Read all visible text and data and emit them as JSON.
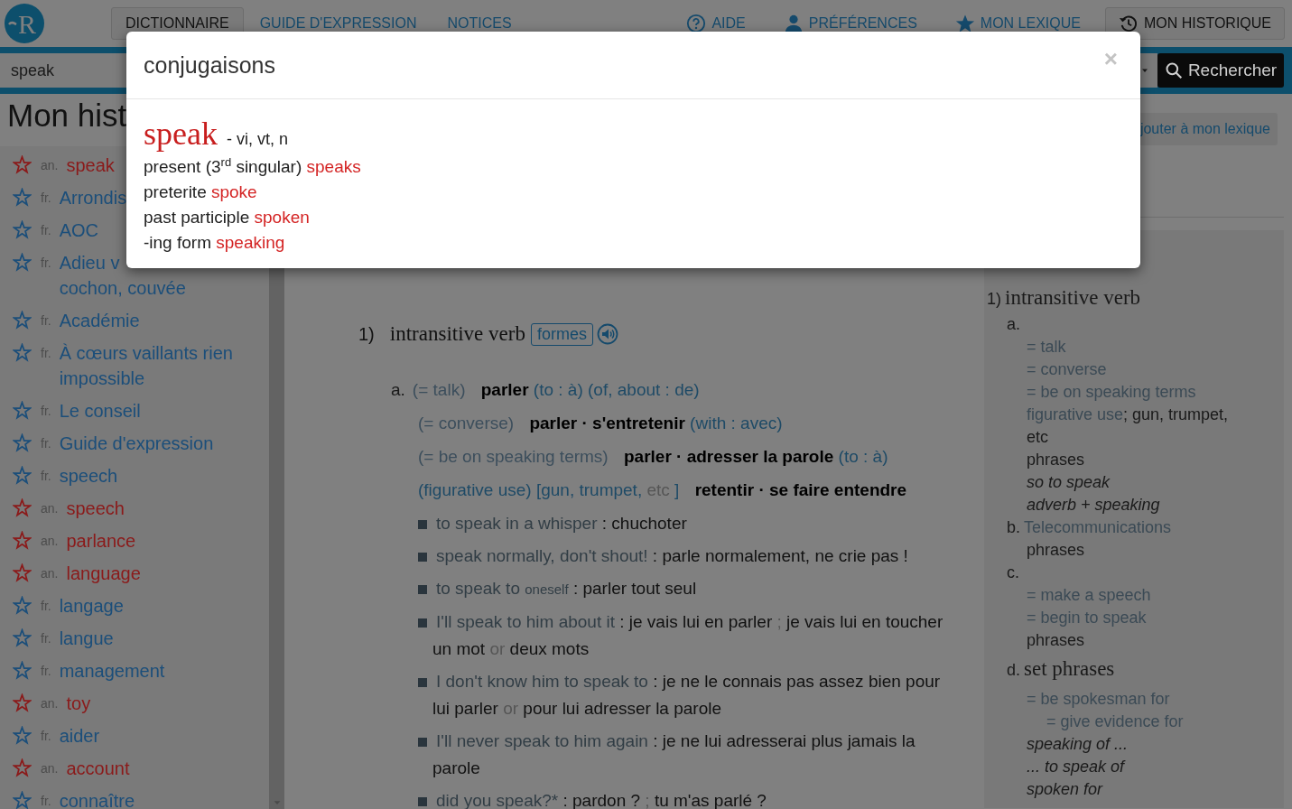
{
  "nav": {
    "logo": "R",
    "tabs": [
      {
        "label": "DICTIONNAIRE",
        "selected": true
      },
      {
        "label": "GUIDE D'EXPRESSION",
        "selected": false
      },
      {
        "label": "NOTICES",
        "selected": false
      }
    ],
    "links": [
      {
        "label": "AIDE",
        "kind": "help",
        "selected": false
      },
      {
        "label": "PRÉFÉRENCES",
        "kind": "user",
        "selected": false
      },
      {
        "label": "MON LEXIQUE",
        "kind": "star",
        "selected": false
      },
      {
        "label": "MON HISTORIQUE",
        "kind": "history",
        "selected": true
      }
    ]
  },
  "search": {
    "value": "speak",
    "button": "Rechercher"
  },
  "history": {
    "title": "Mon hist",
    "items": [
      {
        "lang": "an.",
        "word": "speak",
        "color": "#8b1a1a"
      },
      {
        "lang": "fr.",
        "word": "Arrondis",
        "color": "#1b4e7a"
      },
      {
        "lang": "fr.",
        "word": "AOC",
        "color": "#1b4e7a"
      },
      {
        "lang": "fr.",
        "word": "Adieu v\ncochon, couvée",
        "color": "#1b4e7a"
      },
      {
        "lang": "fr.",
        "word": "Académie",
        "color": "#1b4e7a"
      },
      {
        "lang": "fr.",
        "word": "À cœurs vaillants rien impossible",
        "color": "#1b4e7a"
      },
      {
        "lang": "fr.",
        "word": "Le conseil",
        "color": "#1b4e7a"
      },
      {
        "lang": "fr.",
        "word": "Guide d'expression",
        "color": "#1b4e7a"
      },
      {
        "lang": "fr.",
        "word": "speech",
        "color": "#1b4e7a"
      },
      {
        "lang": "an.",
        "word": "speech",
        "color": "#8b1a1a"
      },
      {
        "lang": "an.",
        "word": "parlance",
        "color": "#8b1a1a"
      },
      {
        "lang": "an.",
        "word": "language",
        "color": "#8b1a1a"
      },
      {
        "lang": "fr.",
        "word": "langage",
        "color": "#1b4e7a"
      },
      {
        "lang": "fr.",
        "word": "langue",
        "color": "#1b4e7a"
      },
      {
        "lang": "fr.",
        "word": "management",
        "color": "#1b4e7a"
      },
      {
        "lang": "an.",
        "word": "toy",
        "color": "#8b1a1a"
      },
      {
        "lang": "fr.",
        "word": "aider",
        "color": "#1b4e7a"
      },
      {
        "lang": "an.",
        "word": "account",
        "color": "#8b1a1a"
      },
      {
        "lang": "fr.",
        "word": "connaître",
        "color": "#1b4e7a"
      }
    ]
  },
  "entry": {
    "sense": {
      "number": "1)",
      "pos": "intransitive verb",
      "forms_button": "formes"
    },
    "lines": [
      {
        "kind": "sense",
        "label": "a.",
        "segments": [
          {
            "kind": "note",
            "text": "(= talk)"
          },
          {
            "kind": "trans",
            "text": "parler"
          },
          {
            "kind": "gloss",
            "text": "(to : à) (of, about : de)"
          }
        ]
      },
      {
        "kind": "sense",
        "segments": [
          {
            "kind": "note",
            "text": "(= converse)"
          },
          {
            "kind": "trans",
            "text": "parler · s'entretenir"
          },
          {
            "kind": "gloss",
            "text": "(with : avec)"
          }
        ]
      },
      {
        "kind": "sense",
        "segments": [
          {
            "kind": "note",
            "text": "(= be on speaking terms)"
          },
          {
            "kind": "trans",
            "text": "parler · adresser la parole"
          },
          {
            "kind": "gloss",
            "text": "(to : à)"
          }
        ]
      },
      {
        "kind": "sense",
        "segments": [
          {
            "kind": "gloss",
            "text": "(figurative use) [gun, trumpet,"
          },
          {
            "kind": "faint",
            "text": "etc"
          },
          {
            "kind": "gloss",
            "text": "]"
          },
          {
            "kind": "trans",
            "text": "retentir · se faire entendre"
          }
        ]
      },
      {
        "kind": "example",
        "segments": [
          {
            "kind": "example",
            "text": "to speak in a whisper"
          },
          {
            "kind": "text",
            "text": ": chuchoter"
          }
        ]
      },
      {
        "kind": "example",
        "segments": [
          {
            "kind": "example",
            "text": "speak normally, don't shout!"
          },
          {
            "kind": "text",
            "text": ": parle normalement, ne crie pas !"
          }
        ]
      },
      {
        "kind": "example",
        "segments": [
          {
            "kind": "example",
            "text": "to speak to"
          },
          {
            "kind": "small",
            "text": "oneself"
          },
          {
            "kind": "text",
            "text": ": parler tout seul"
          }
        ]
      },
      {
        "kind": "example",
        "segments": [
          {
            "kind": "example",
            "text": "I'll speak to him about it"
          },
          {
            "kind": "text",
            "text": ": je vais lui en parler"
          },
          {
            "kind": "faint",
            "text": ";"
          },
          {
            "kind": "text",
            "text": "je vais lui en toucher un mot"
          },
          {
            "kind": "faint",
            "text": "or"
          },
          {
            "kind": "text",
            "text": "deux mots"
          }
        ]
      },
      {
        "kind": "example",
        "segments": [
          {
            "kind": "example",
            "text": "I don't know him to speak to"
          },
          {
            "kind": "text",
            "text": ": je ne le connais pas assez bien pour lui parler"
          },
          {
            "kind": "faint",
            "text": "or"
          },
          {
            "kind": "text",
            "text": "pour lui adresser la parole"
          }
        ]
      },
      {
        "kind": "example",
        "segments": [
          {
            "kind": "example",
            "text": "I'll never speak to him again"
          },
          {
            "kind": "text",
            "text": ": je ne lui adresserai plus jamais la parole"
          }
        ]
      },
      {
        "kind": "example",
        "segments": [
          {
            "kind": "example",
            "text": "did you speak?*"
          },
          {
            "kind": "text",
            "text": ": pardon ?"
          },
          {
            "kind": "faint",
            "text": ";"
          },
          {
            "kind": "text",
            "text": "tu m'as parlé ?"
          }
        ]
      }
    ]
  },
  "side": {
    "button": "jouter à mon lexique",
    "outline": [
      {
        "label": "1)",
        "text": "intransitive verb",
        "kind": "heading",
        "children": [
          {
            "label": "a.",
            "children": [
              {
                "note": "= talk"
              },
              {
                "note": "= converse"
              },
              {
                "note": "= be on speaking terms"
              },
              {
                "note": "figurative use",
                "text": "; gun, trumpet, etc"
              },
              {
                "text": "phrases"
              },
              {
                "text": "so to speak",
                "kind": "italic"
              },
              {
                "text": "adverb + speaking",
                "kind": "italic"
              }
            ]
          },
          {
            "label": "b.",
            "note": "Telecommunications",
            "children": [
              {
                "text": "phrases"
              }
            ]
          },
          {
            "label": "c.",
            "children": [
              {
                "note": "= make a speech"
              },
              {
                "note": "= begin to speak"
              },
              {
                "text": "phrases"
              }
            ]
          },
          {
            "label": "d.",
            "text": "set phrases",
            "kind": "heading",
            "children": [
              {
                "note": "= be spokesman for",
                "children": [
                  {
                    "note": "= give evidence for"
                  }
                ]
              },
              {
                "text": "speaking of ...",
                "kind": "italic"
              },
              {
                "text": "... to speak of",
                "kind": "italic"
              },
              {
                "text": "spoken for",
                "kind": "italic"
              }
            ]
          }
        ]
      }
    ]
  },
  "modal": {
    "title": "conjugaisons",
    "close": "×",
    "headword": "speak",
    "pos": "- vi, vt, n",
    "rows": [
      {
        "label": "present (3$^{rd}$ singular)",
        "form": "speaks"
      },
      {
        "label": "preterite",
        "form": "spoke"
      },
      {
        "label": "past participle",
        "form": "spoken"
      },
      {
        "label": "-ing form",
        "form": "speaking"
      }
    ]
  }
}
